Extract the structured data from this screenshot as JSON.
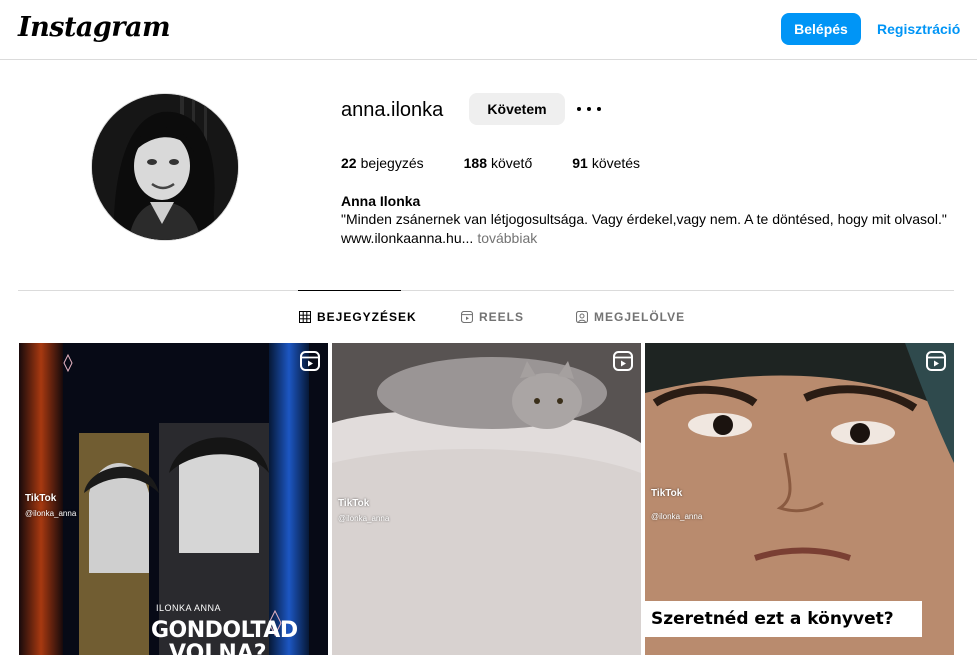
{
  "nav": {
    "logo": "Instagram",
    "login_label": "Belépés",
    "register_label": "Regisztráció"
  },
  "profile": {
    "username": "anna.ilonka",
    "follow_label": "Követem",
    "stats": [
      {
        "count": "22",
        "label": "bejegyzés"
      },
      {
        "count": "188",
        "label": "követő"
      },
      {
        "count": "91",
        "label": "követés"
      }
    ],
    "full_name": "Anna Ilonka",
    "bio": "\"Minden zsánernek van létjogosultsága. Vagy érdekel,vagy nem. A te döntésed, hogy mit olvasol.\"",
    "link": "www.ilonkaanna.hu...",
    "more_label": "továbbiak"
  },
  "tabs": [
    {
      "label": "BEJEGYZÉSEK",
      "icon": "grid-icon"
    },
    {
      "label": "REELS",
      "icon": "reels-icon"
    },
    {
      "label": "MEGJELÖLVE",
      "icon": "tagged-icon"
    }
  ],
  "posts": [
    {
      "tiktok": "TikTok",
      "handle": "@ilonka_anna",
      "author": "ILONKA ANNA",
      "title": "GONDOLTAD",
      "title2": "VOLNA?"
    },
    {
      "tiktok": "TikTok",
      "handle": "@ilonka_anna"
    },
    {
      "tiktok": "TikTok",
      "handle": "@ilonka_anna",
      "caption": "Szeretnéd ezt a könyvet?"
    }
  ],
  "colors": {
    "accent": "#0095f6",
    "border": "#dbdbdb",
    "muted": "#737373"
  }
}
